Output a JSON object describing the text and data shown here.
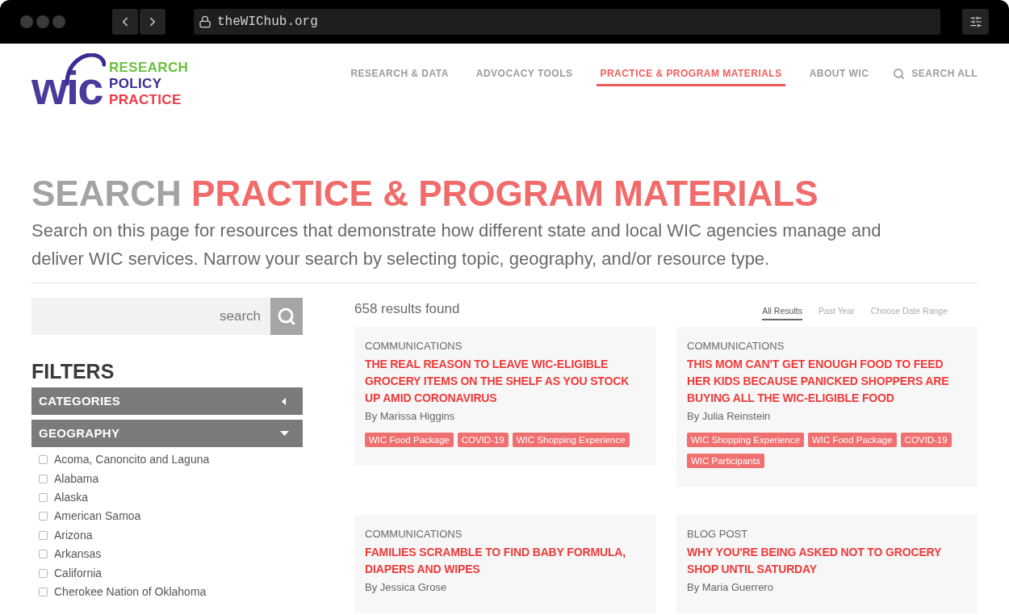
{
  "browser": {
    "url": "theWIChub.org"
  },
  "logo": {
    "mark": "wic",
    "lines": [
      {
        "text": "RESEARCH",
        "color": "#6cbf3c"
      },
      {
        "text": "POLICY",
        "color": "#3b2d91"
      },
      {
        "text": "PRACTICE",
        "color": "#ee3a45"
      }
    ]
  },
  "nav": [
    {
      "label": "RESEARCH & DATA",
      "kind": "link",
      "selected": false
    },
    {
      "label": "ADVOCACY TOOLS",
      "kind": "link",
      "selected": false
    },
    {
      "label": "PRACTICE & PROGRAM MATERIALS",
      "kind": "link",
      "selected": true
    },
    {
      "label": "ABOUT WIC",
      "kind": "link",
      "selected": false
    },
    {
      "label": "SEARCH ALL",
      "kind": "search",
      "selected": false
    }
  ],
  "page": {
    "heading": {
      "lead": "SEARCH",
      "topic": "PRACTICE & PROGRAM MATERIALS"
    },
    "description": "Search on this page for resources that demonstrate how different state and local WIC agencies manage and deliver WIC services. Narrow your search by selecting topic, geography, and/or resource type."
  },
  "search": {
    "placeholder": "search"
  },
  "filters": {
    "title": "FILTERS",
    "groups": [
      {
        "label": "CATEGORIES",
        "expanded": false
      },
      {
        "label": "GEOGRAPHY",
        "expanded": true,
        "options": [
          {
            "label": "Acoma, Canoncito and Laguna",
            "checked": false
          },
          {
            "label": "Alabama",
            "checked": false
          },
          {
            "label": "Alaska",
            "checked": false
          },
          {
            "label": "American Samoa",
            "checked": false
          },
          {
            "label": "Arizona",
            "checked": false
          },
          {
            "label": "Arkansas",
            "checked": false
          },
          {
            "label": "California",
            "checked": false
          },
          {
            "label": "Cherokee Nation of Oklahoma",
            "checked": false
          }
        ]
      }
    ]
  },
  "results": {
    "count": "658 results found",
    "date_tabs": [
      {
        "label": "All Results",
        "selected": true
      },
      {
        "label": "Past Year",
        "selected": false
      },
      {
        "label": "Choose Date Range",
        "selected": false
      }
    ],
    "cards": [
      {
        "category": "COMMUNICATIONS",
        "title": "THE REAL REASON TO LEAVE WIC-ELIGIBLE GROCERY ITEMS ON THE SHELF AS YOU STOCK UP AMID CORONAVIRUS",
        "author": "By Marissa Higgins",
        "tags": [
          "WIC Food Package",
          "COVID-19",
          "WIC Shopping Experience"
        ]
      },
      {
        "category": "COMMUNICATIONS",
        "title": "THIS MOM CAN'T GET ENOUGH FOOD TO FEED HER KIDS BECAUSE PANICKED SHOPPERS ARE BUYING ALL THE WIC-ELIGIBLE FOOD",
        "author": "By Julia Reinstein",
        "tags": [
          "WIC Shopping Experience",
          "WIC Food Package",
          "COVID-19",
          "WIC Participants"
        ]
      },
      {
        "category": "COMMUNICATIONS",
        "title": "FAMILIES SCRAMBLE TO FIND BABY FORMULA, DIAPERS AND WIPES",
        "author": "By Jessica Grose"
      },
      {
        "category": "BLOG POST",
        "title": "WHY YOU'RE BEING ASKED NOT TO GROCERY SHOP UNTIL SATURDAY",
        "author": "By Maria Guerrero"
      }
    ]
  }
}
